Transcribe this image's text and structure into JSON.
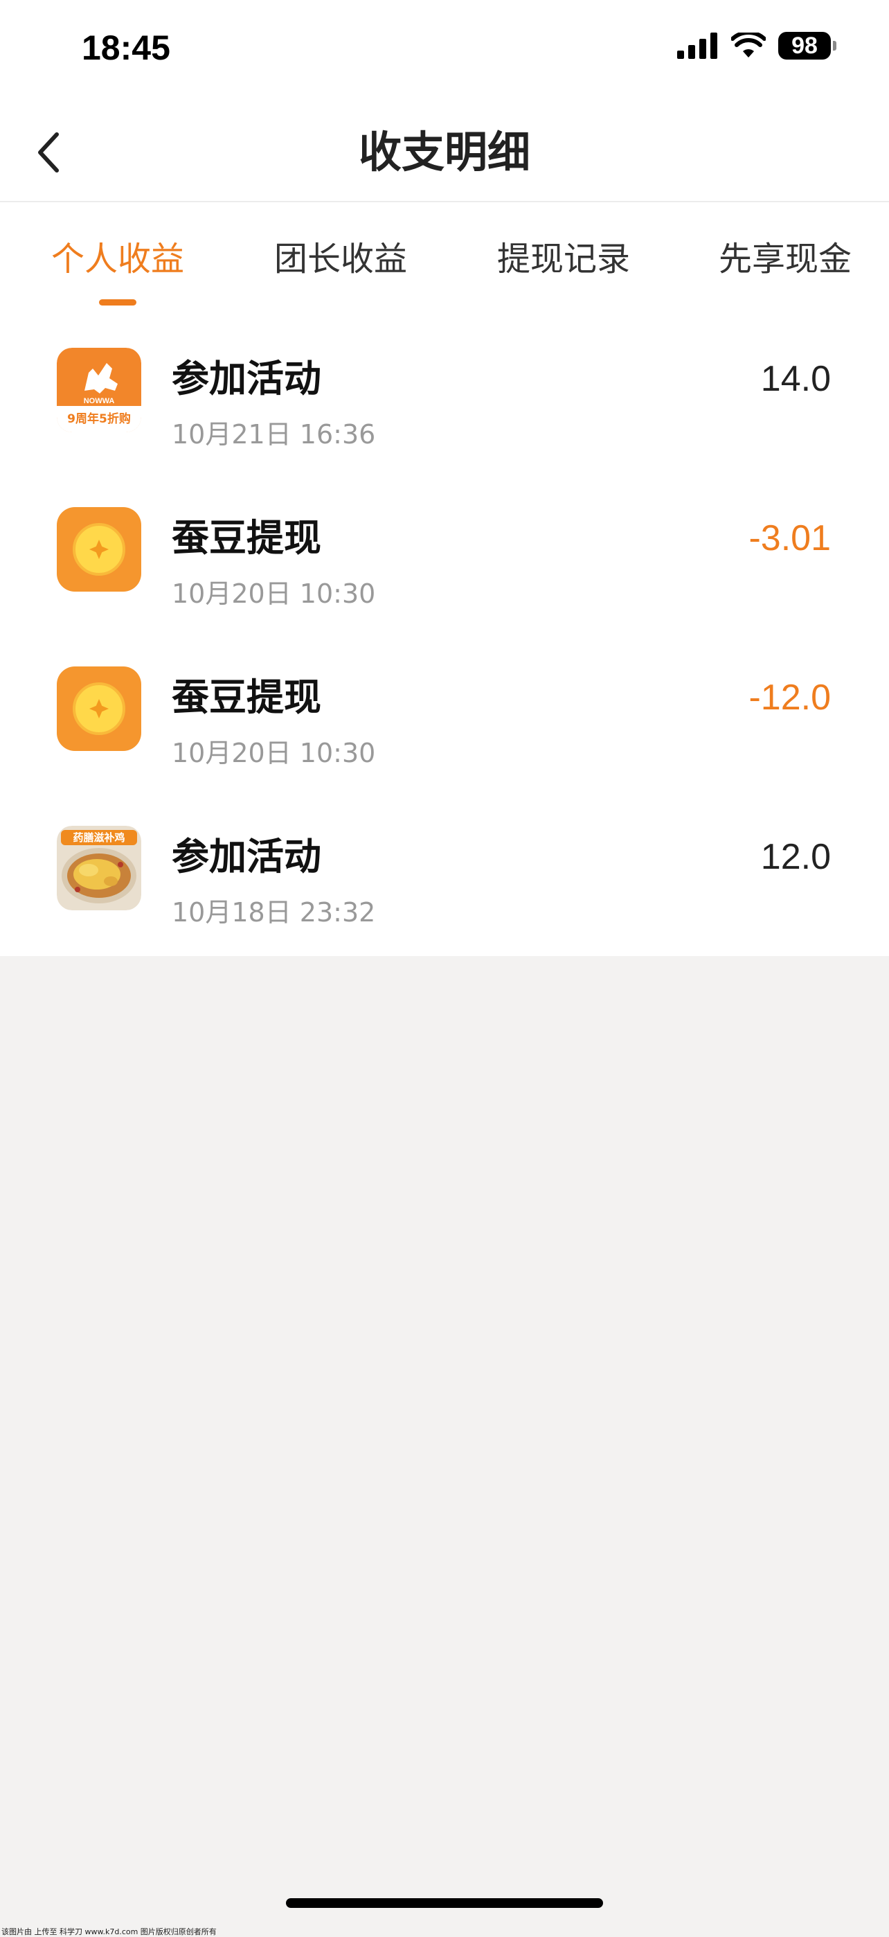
{
  "status_bar": {
    "time": "18:45",
    "battery": "98",
    "icons": [
      "cellular-signal-icon",
      "wifi-icon",
      "battery-icon"
    ]
  },
  "nav": {
    "title": "收支明细",
    "back_icon": "chevron-left-icon"
  },
  "tabs": [
    {
      "label": "个人收益",
      "active": true
    },
    {
      "label": "团长收益",
      "active": false
    },
    {
      "label": "提现记录",
      "active": false
    },
    {
      "label": "先享现金",
      "active": false
    }
  ],
  "records": [
    {
      "title": "参加活动",
      "time": "10月21日 16:36",
      "amount": "14.0",
      "type": "income",
      "icon": "nowwa-brand-icon",
      "icon_text": "NOWWA",
      "icon_badge": "9周年5折购"
    },
    {
      "title": "蚕豆提现",
      "time": "10月20日 10:30",
      "amount": "-3.01",
      "type": "withdraw",
      "icon": "gold-coin-icon"
    },
    {
      "title": "蚕豆提现",
      "time": "10月20日 10:30",
      "amount": "-12.0",
      "type": "withdraw",
      "icon": "gold-coin-icon"
    },
    {
      "title": "参加活动",
      "time": "10月18日 23:32",
      "amount": "12.0",
      "type": "income",
      "icon": "roast-chicken-photo-icon",
      "icon_text": "药膳滋补鸡"
    }
  ],
  "colors": {
    "accent": "#ef7d1e",
    "background": "#f3f2f1",
    "card": "#ffffff"
  },
  "footer": {
    "watermark": "该图片由 上传至 科学刀 www.k7d.com 图片版权归原创者所有"
  }
}
